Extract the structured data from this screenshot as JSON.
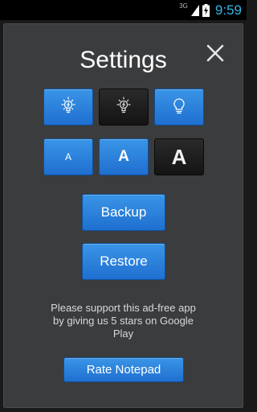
{
  "status": {
    "network": "3G",
    "time": "9:59"
  },
  "dialog": {
    "title": "Settings",
    "size_small": "A",
    "size_medium": "A",
    "size_large": "A",
    "backup_label": "Backup",
    "restore_label": "Restore",
    "support_text": "Please support this ad-free app by giving us 5 stars on Google Play",
    "rate_label": "Rate Notepad"
  },
  "colors": {
    "accent_blue": "#2a82dc",
    "clock_blue": "#33b5e5",
    "panel_bg": "#3b3c3e"
  }
}
